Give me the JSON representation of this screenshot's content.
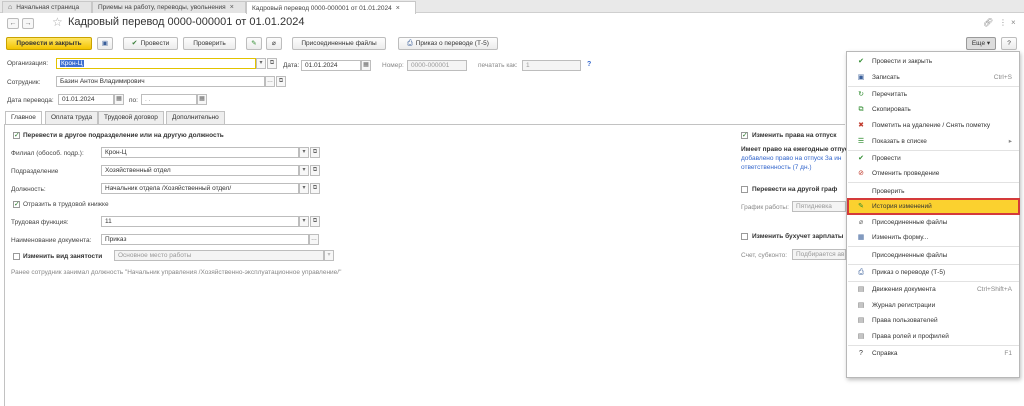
{
  "tabs": [
    {
      "label": "Начальная страница",
      "closable": false
    },
    {
      "label": "Приемы на работу, переводы, увольнения",
      "closable": true
    },
    {
      "label": "Кадровый перевод 0000-000001 от 01.01.2024",
      "closable": true
    }
  ],
  "title": "Кадровый перевод 0000-000001 от 01.01.2024",
  "toolbar": {
    "post_close": "Провести и закрыть",
    "post": "Провести",
    "check": "Проверить",
    "attached": "Присоединенные файлы",
    "order": "Приказ о переводе (Т-5)",
    "more": "Еще",
    "more_arrow": "▾",
    "help": "?"
  },
  "header_fields": {
    "org_label": "Организация:",
    "org_value": "Крон-Ц",
    "date_label": "Дата:",
    "date_value": "01.01.2024",
    "number_label": "Номер:",
    "number_value": "0000-000001",
    "print_label": "печатать как:",
    "print_value": "1",
    "employee_label": "Сотрудник:",
    "employee_value": "Базин Антон Владимирович",
    "transfer_date_label": "Дата перевода:",
    "transfer_date_value": "01.01.2024",
    "to_label": "по:",
    "to_value": ". .",
    "help_mark": "?"
  },
  "inner_tabs": [
    "Главное",
    "Оплата труда",
    "Трудовой договор",
    "Дополнительно"
  ],
  "main": {
    "transfer_check": "Перевести в другое подразделение или на другую должность",
    "branch_label": "Филиал (обособ. подр.):",
    "branch_value": "Крон-Ц",
    "dept_label": "Подразделение",
    "dept_value": "Хозяйственный отдел",
    "position_label": "Должность:",
    "position_value": "Начальник отдела /Хозяйственный отдел/",
    "record_check": "Отразить в трудовой книжке",
    "function_label": "Трудовая функция:",
    "function_value": "11",
    "docname_label": "Наименование документа:",
    "docname_value": "Приказ",
    "emptype_check": "Изменить вид занятости",
    "emptype_value": "Основное место работы",
    "prev_note": "Ранее сотрудник занимал должность \"Начальник управления /Хозяйственно-эксплуатационное управление/\""
  },
  "right_panel": {
    "leave_check": "Изменить права на отпуск",
    "leave_text1": "Имеет право на ежегодные отпус",
    "leave_text2": "добавлено право на отпуск За ин",
    "leave_text3": "ответственность (7 дн.)",
    "schedule_check": "Перевести на другой граф",
    "schedule_label": "График работы:",
    "schedule_value": "Пятидневка",
    "accounting_check": "Изменить бухучет зарплаты",
    "account_label": "Счет, субконто:",
    "account_placeholder": "Подбирается ав"
  },
  "menu": [
    {
      "label": "Провести и закрыть",
      "icon": "check-doc-icon",
      "glyph": "✔",
      "color": "#2e8b2e",
      "key": ""
    },
    {
      "label": "Записать",
      "icon": "save-icon",
      "glyph": "▣",
      "color": "#3a5f9a",
      "key": "Ctrl+S"
    },
    {
      "sep": true
    },
    {
      "label": "Перечитать",
      "icon": "refresh-icon",
      "glyph": "↻",
      "color": "#2e8b2e",
      "key": ""
    },
    {
      "label": "Скопировать",
      "icon": "copy-icon",
      "glyph": "⧉",
      "color": "#2e8b2e",
      "key": ""
    },
    {
      "label": "Пометить на удаление / Снять пометку",
      "icon": "delete-mark-icon",
      "glyph": "✖",
      "color": "#c0392b",
      "key": ""
    },
    {
      "label": "Показать в списке",
      "icon": "list-icon",
      "glyph": "☰",
      "color": "#2e8b2e",
      "key": "▸"
    },
    {
      "sep": true
    },
    {
      "label": "Провести",
      "icon": "post-icon",
      "glyph": "✔",
      "color": "#2e8b2e",
      "key": ""
    },
    {
      "label": "Отменить проведение",
      "icon": "unpost-icon",
      "glyph": "⊘",
      "color": "#c0392b",
      "key": ""
    },
    {
      "sep": true
    },
    {
      "label": "Проверить",
      "icon": "",
      "glyph": "",
      "color": "#333",
      "key": ""
    },
    {
      "label": "История изменений",
      "icon": "history-icon",
      "glyph": "✎",
      "color": "#2e8b2e",
      "key": "",
      "highlight": true
    },
    {
      "label": "Присоединенные файлы",
      "icon": "paperclip-icon",
      "glyph": "⌀",
      "color": "#666",
      "key": ""
    },
    {
      "label": "Изменить форму...",
      "icon": "form-icon",
      "glyph": "▦",
      "color": "#3a5f9a",
      "key": ""
    },
    {
      "sep": true
    },
    {
      "label": "Присоединенные файлы",
      "icon": "",
      "glyph": "",
      "color": "#333",
      "key": ""
    },
    {
      "sep": true
    },
    {
      "label": "Приказ о переводе (Т-5)",
      "icon": "print-icon",
      "glyph": "⎙",
      "color": "#3a5f9a",
      "key": ""
    },
    {
      "sep": true
    },
    {
      "label": "Движения документа",
      "icon": "movements-icon",
      "glyph": "▤",
      "color": "#666",
      "key": "Ctrl+Shift+A"
    },
    {
      "label": "Журнал регистрации",
      "icon": "journal-icon",
      "glyph": "▤",
      "color": "#666",
      "key": ""
    },
    {
      "label": "Права пользователей",
      "icon": "rights-icon",
      "glyph": "▤",
      "color": "#666",
      "key": ""
    },
    {
      "label": "Права ролей и профилей",
      "icon": "roles-icon",
      "glyph": "▤",
      "color": "#666",
      "key": ""
    },
    {
      "sep": true
    },
    {
      "label": "Справка",
      "icon": "help-icon",
      "glyph": "?",
      "color": "#333",
      "key": "F1"
    }
  ]
}
